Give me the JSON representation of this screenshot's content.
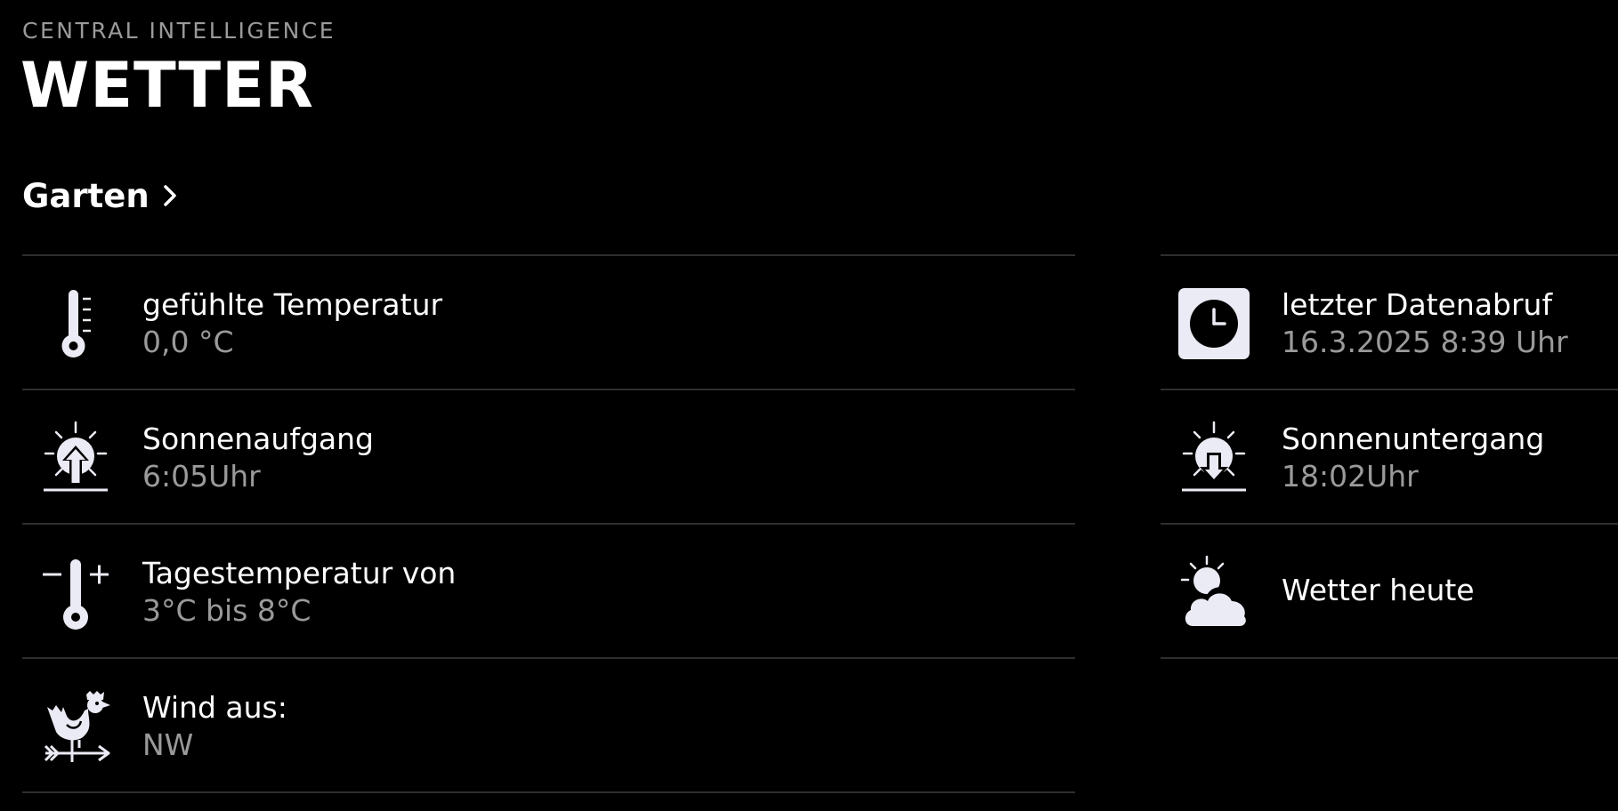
{
  "header": {
    "eyebrow": "CENTRAL INTELLIGENCE",
    "title": "WETTER"
  },
  "location": {
    "label": "Garten",
    "icon": "chevron-right-icon"
  },
  "left_rows": [
    {
      "icon": "thermometer-icon",
      "label": "gefühlte Temperatur",
      "value": "0,0 °C"
    },
    {
      "icon": "sunrise-icon",
      "label": "Sonnenaufgang",
      "value": "6:05Uhr"
    },
    {
      "icon": "thermometer-range-icon",
      "label": "Tagestemperatur von",
      "value": "3°C bis 8°C"
    },
    {
      "icon": "weathervane-rooster-icon",
      "label": "Wind aus:",
      "value": "NW"
    }
  ],
  "right_rows": [
    {
      "icon": "clock-icon",
      "label": "letzter Datenabruf",
      "value": "16.3.2025 8:39 Uhr"
    },
    {
      "icon": "sunset-icon",
      "label": "Sonnenuntergang",
      "value": "18:02Uhr"
    },
    {
      "icon": "partly-cloudy-icon",
      "label": "Wetter heute"
    }
  ],
  "colors": {
    "background": "#000000",
    "text": "#ffffff",
    "muted": "#9a9a9a",
    "divider": "#2e2e2e",
    "icon_fill": "#ebebf5"
  }
}
